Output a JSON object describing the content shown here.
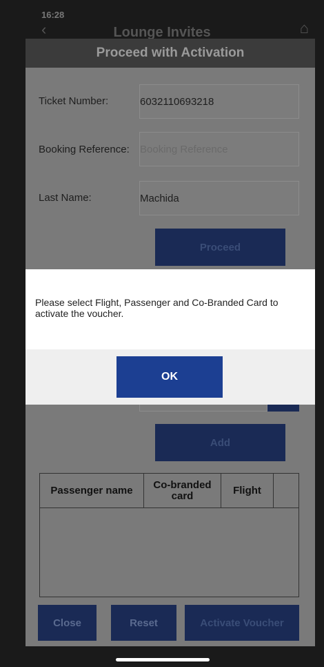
{
  "status_bar": {
    "time": "16:28"
  },
  "app": {
    "title": "Lounge Invites"
  },
  "dialog": {
    "title": "Proceed with Activation",
    "ticket_label": "Ticket Number:",
    "ticket_value": "6032110693218",
    "booking_label": "Booking Reference:",
    "booking_placeholder": "Booking Reference",
    "lastname_label": "Last Name:",
    "lastname_value": "Machida",
    "proceed_label": "Proceed",
    "add_label": "Add",
    "table": {
      "headers": [
        "Passenger name",
        "Co-branded card",
        "Flight",
        ""
      ]
    },
    "close_label": "Close",
    "reset_label": "Reset",
    "activate_label": "Activate Voucher"
  },
  "alert": {
    "message": "Please select Flight, Passenger and Co-Branded Card to activate the voucher.",
    "ok_label": "OK",
    "accent": "#1c3f92"
  }
}
